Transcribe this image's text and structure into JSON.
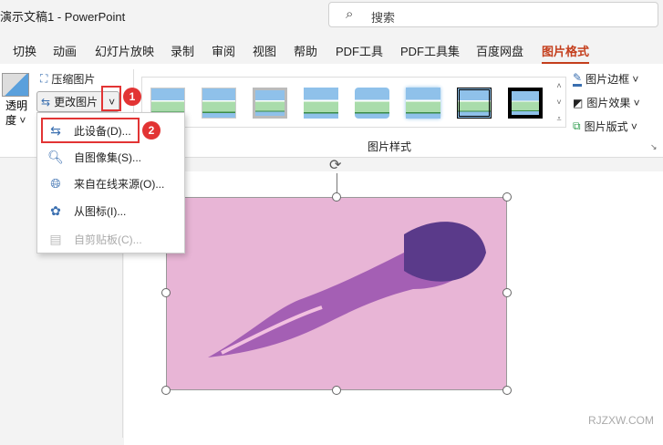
{
  "window": {
    "title": "演示文稿1  -  PowerPoint",
    "search_placeholder": "搜索"
  },
  "tabs": [
    "切换",
    "动画",
    "幻灯片放映",
    "录制",
    "审阅",
    "视图",
    "帮助",
    "PDF工具",
    "PDF工具集",
    "百度网盘",
    "图片格式"
  ],
  "ribbon": {
    "transparency": "透明度",
    "transparency_line1": "透明",
    "transparency_line2": "度 ˅",
    "compress": "压缩图片",
    "change_picture": "更改图片",
    "styles_group": "图片样式",
    "border": "图片边框 ˅",
    "effects": "图片效果 ˅",
    "layout": "图片版式 ˅"
  },
  "menu": [
    {
      "label": "此设备(D)...",
      "enabled": true
    },
    {
      "label": "自图像集(S)...",
      "enabled": true
    },
    {
      "label": "来自在线来源(O)...",
      "enabled": true
    },
    {
      "label": "从图标(I)...",
      "enabled": true
    },
    {
      "label": "自剪贴板(C)...",
      "enabled": false
    }
  ],
  "badges": [
    "1",
    "2"
  ],
  "watermark": "RJZXW.COM",
  "colors": {
    "accent": "#c43e1c",
    "highlight": "#e23434",
    "picture_bg": "#e8b5d6"
  }
}
